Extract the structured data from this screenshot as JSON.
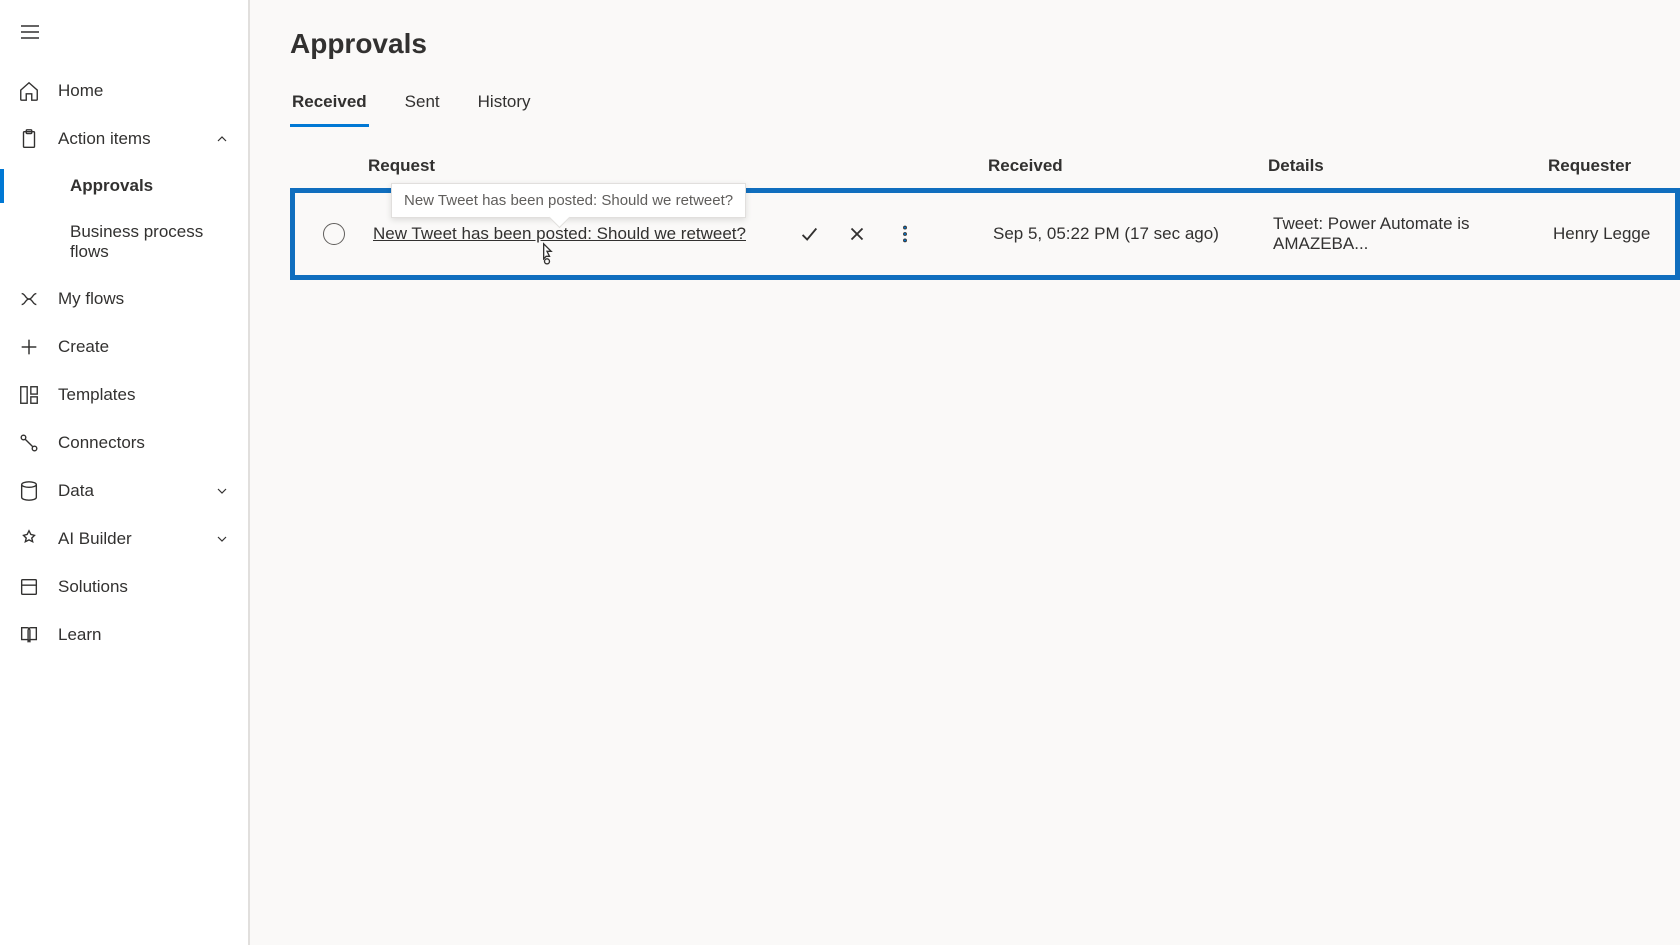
{
  "sidebar": {
    "items": [
      {
        "label": "Home"
      },
      {
        "label": "Action items"
      },
      {
        "label": "Approvals"
      },
      {
        "label": "Business process flows"
      },
      {
        "label": "My flows"
      },
      {
        "label": "Create"
      },
      {
        "label": "Templates"
      },
      {
        "label": "Connectors"
      },
      {
        "label": "Data"
      },
      {
        "label": "AI Builder"
      },
      {
        "label": "Solutions"
      },
      {
        "label": "Learn"
      }
    ]
  },
  "page": {
    "title": "Approvals"
  },
  "tabs": [
    {
      "label": "Received",
      "active": true
    },
    {
      "label": "Sent"
    },
    {
      "label": "History"
    }
  ],
  "table": {
    "columns": {
      "request": "Request",
      "received": "Received",
      "details": "Details",
      "requester": "Requester"
    },
    "rows": [
      {
        "title": "New Tweet has been posted: Should we retweet?",
        "received": "Sep 5, 05:22 PM (17 sec ago)",
        "details": "Tweet: Power Automate is AMAZEBA...",
        "requester": "Henry Legge"
      }
    ]
  },
  "tooltip": {
    "text": "New Tweet has been posted: Should we retweet?"
  }
}
